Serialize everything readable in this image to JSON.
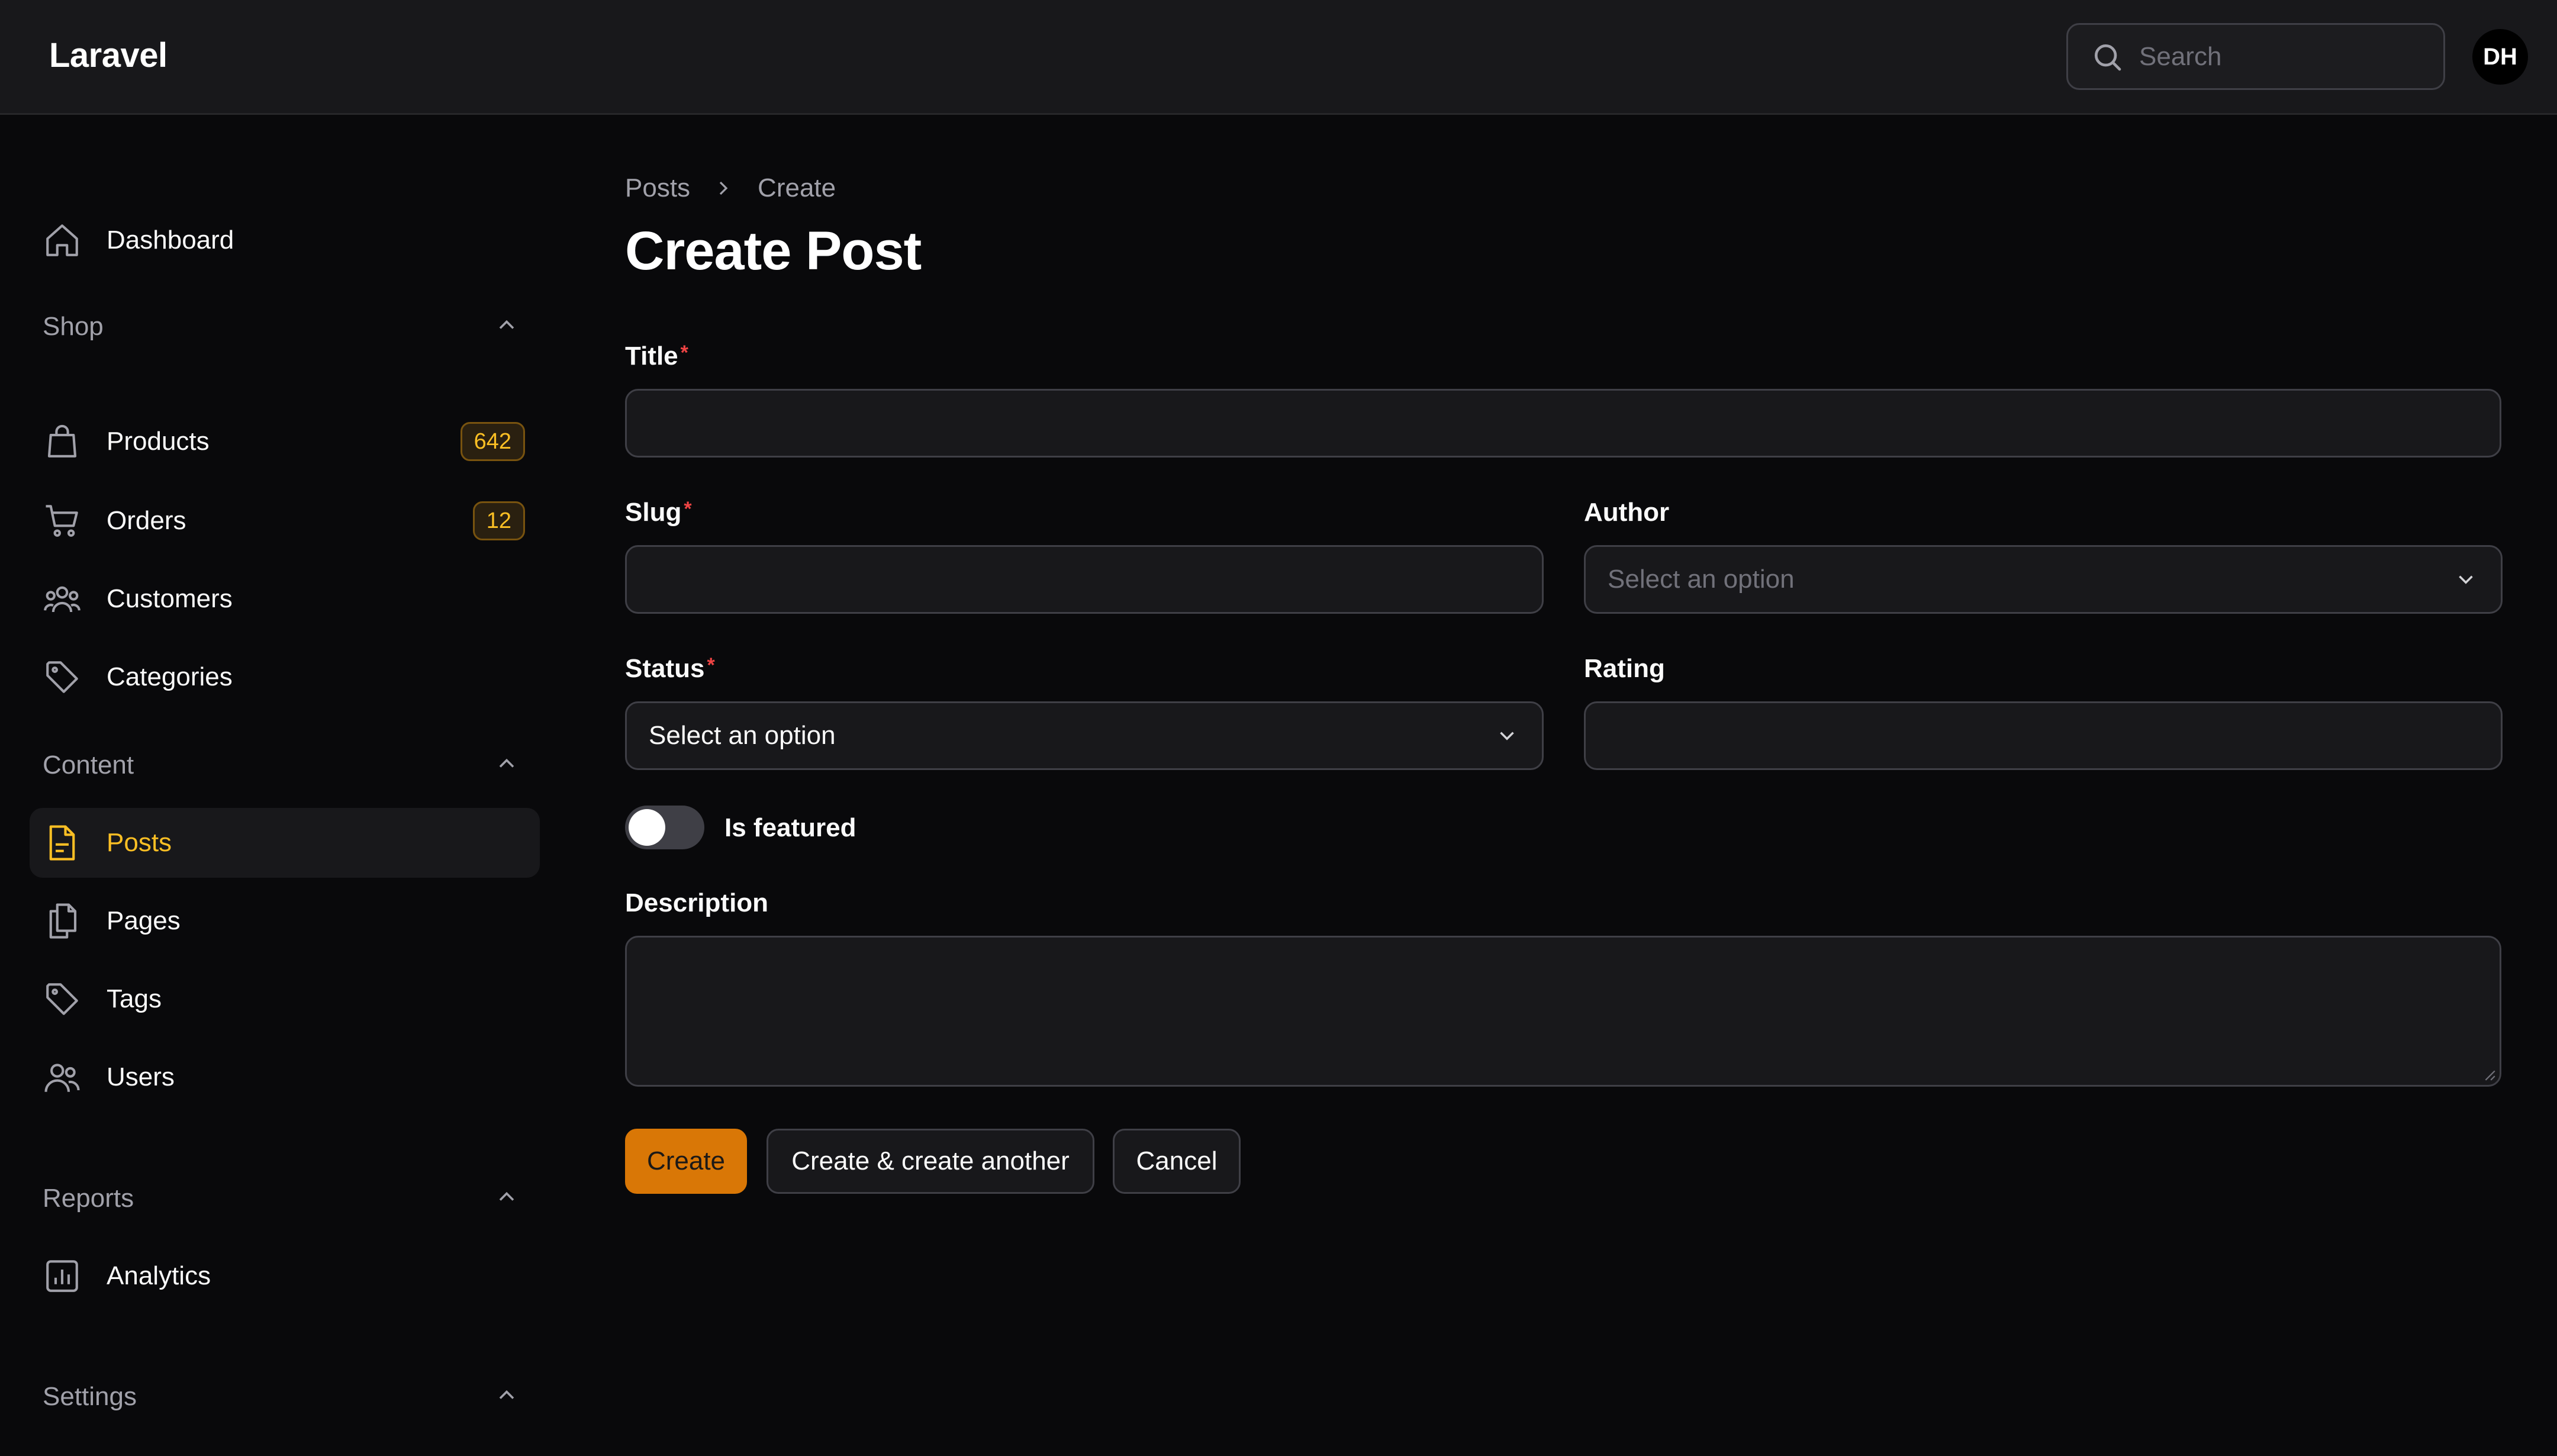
{
  "topbar": {
    "brand": "Laravel",
    "search_placeholder": "Search",
    "avatar_initials": "DH"
  },
  "sidebar": {
    "dashboard": {
      "label": "Dashboard",
      "icon": "home-icon"
    },
    "groups": {
      "shop": {
        "label": "Shop",
        "items": [
          {
            "label": "Products",
            "icon": "shopping-bag-icon",
            "badge": "642"
          },
          {
            "label": "Orders",
            "icon": "shopping-cart-icon",
            "badge": "12"
          },
          {
            "label": "Customers",
            "icon": "users-group-icon"
          },
          {
            "label": "Categories",
            "icon": "tag-icon"
          }
        ]
      },
      "content": {
        "label": "Content",
        "items": [
          {
            "label": "Posts",
            "icon": "document-text-icon",
            "active": true
          },
          {
            "label": "Pages",
            "icon": "documents-icon"
          },
          {
            "label": "Tags",
            "icon": "tag-icon"
          },
          {
            "label": "Users",
            "icon": "users-icon"
          }
        ]
      },
      "reports": {
        "label": "Reports",
        "items": [
          {
            "label": "Analytics",
            "icon": "chart-bar-icon"
          }
        ]
      },
      "settings": {
        "label": "Settings"
      }
    }
  },
  "main": {
    "breadcrumbs": [
      "Posts",
      "Create"
    ],
    "title": "Create Post",
    "form": {
      "title": {
        "label": "Title",
        "required": "*",
        "value": ""
      },
      "slug": {
        "label": "Slug",
        "required": "*",
        "value": ""
      },
      "author": {
        "label": "Author",
        "placeholder": "Select an option"
      },
      "status": {
        "label": "Status",
        "required": "*",
        "value": "Select an option"
      },
      "rating": {
        "label": "Rating",
        "value": ""
      },
      "is_featured": {
        "label": "Is featured",
        "checked": false
      },
      "description": {
        "label": "Description",
        "value": ""
      }
    },
    "actions": {
      "create": "Create",
      "create_another": "Create & create another",
      "cancel": "Cancel"
    }
  },
  "colors": {
    "accent": "#d97706",
    "active_text": "#fbbf24",
    "required": "#ef4444",
    "background": "#09090b",
    "surface": "#18181b"
  }
}
